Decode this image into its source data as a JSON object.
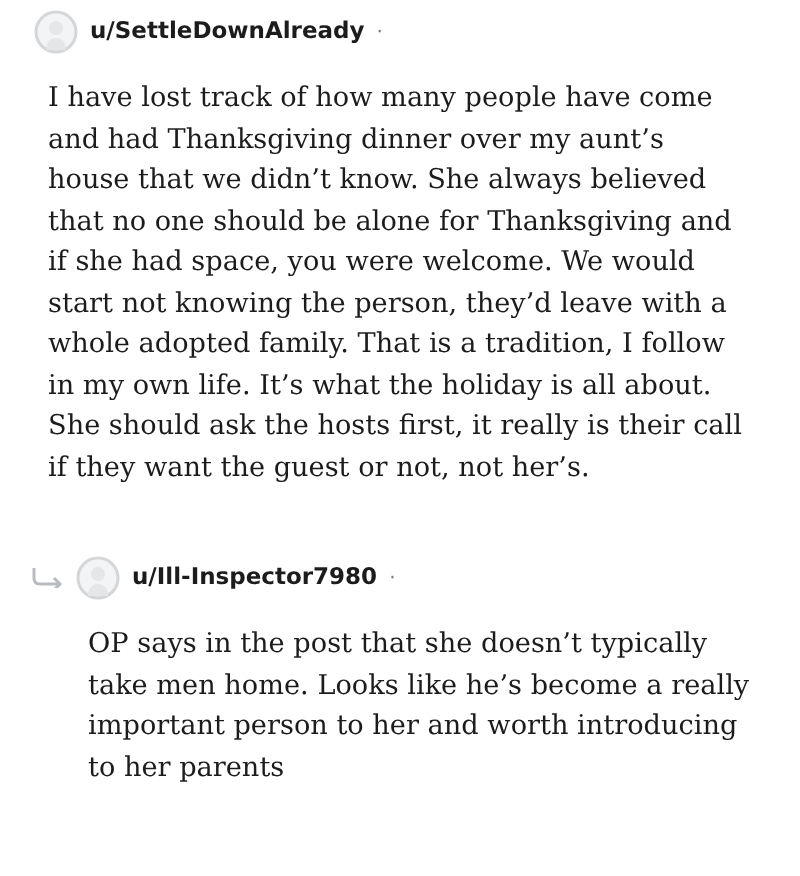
{
  "comments": [
    {
      "username": "u/SettleDownAlready",
      "separator": "·",
      "body": "I have lost track of how many people have come and had Thanksgiving dinner over my aunt’s house that we didn’t know. She always believed that no one should be alone for Thanksgiving and if she had space, you were welcome. We would start not knowing the person, they’d leave with a whole adopted family. That is a tradition, I follow in my own life. It’s what the holiday is all about. She should ask the hosts first, it really is their call if they want the guest or not, not her’s.",
      "reply": false
    },
    {
      "username": "u/Ill-Inspector7980",
      "separator": "·",
      "body": "OP says in the post that she doesn’t typically take men home. Looks like he’s become a really important person to her and worth introducing to her parents",
      "reply": true
    }
  ]
}
